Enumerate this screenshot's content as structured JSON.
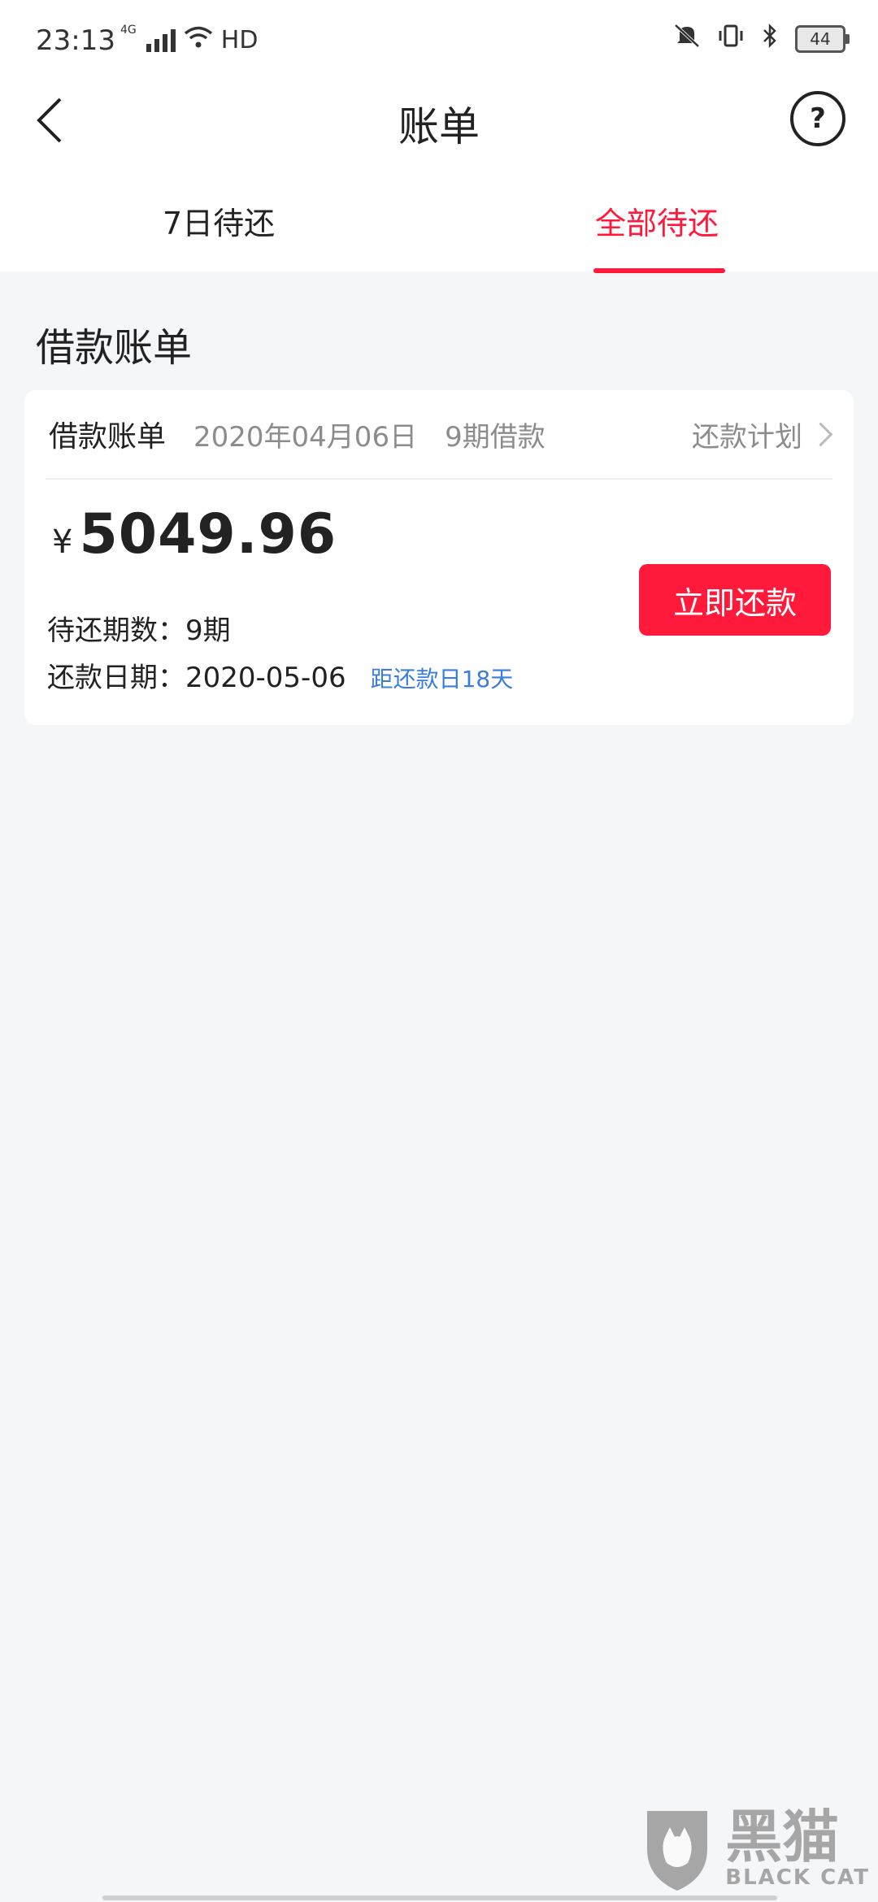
{
  "status_bar": {
    "time": "23:13",
    "network": "4G",
    "hd": "HD",
    "battery": "44"
  },
  "header": {
    "title": "账单",
    "help": "?"
  },
  "tabs": [
    {
      "label": "7日待还",
      "active": false
    },
    {
      "label": "全部待还",
      "active": true
    }
  ],
  "section_title": "借款账单",
  "bill": {
    "title": "借款账单",
    "date": "2020年04月06日",
    "term": "9期借款",
    "plan_link": "还款计划",
    "currency": "¥",
    "amount": "5049.96",
    "pending_periods_label": "待还期数：",
    "pending_periods": "9期",
    "due_date_label": "还款日期：",
    "due_date": "2020-05-06",
    "countdown": "距还款日18天",
    "pay_button": "立即还款"
  },
  "watermark": {
    "cn": "黑猫",
    "en": "BLACK CAT"
  },
  "colors": {
    "accent": "#ff1a3c",
    "link": "#3b7ddd",
    "background": "#f5f6f8"
  }
}
